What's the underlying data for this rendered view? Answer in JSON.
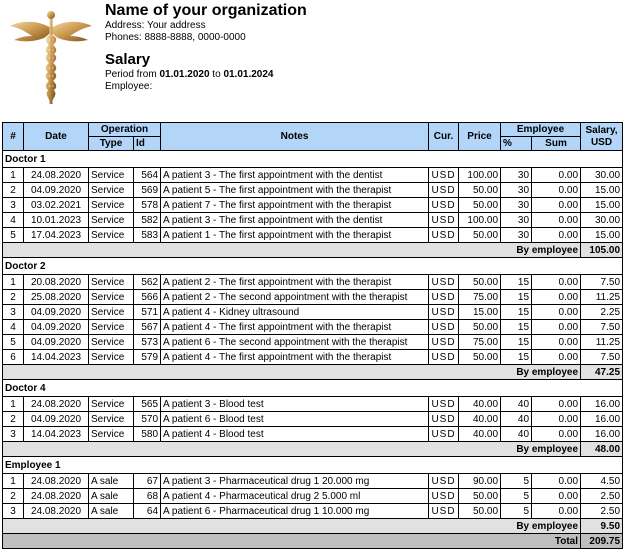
{
  "header": {
    "org_name": "Name of your organization",
    "address": "Address: Your address",
    "phones": "Phones: 8888-8888, 0000-0000",
    "title": "Salary",
    "period_prefix": "Period from ",
    "period_from": "01.01.2020",
    "period_mid": " to ",
    "period_to": "01.01.2024",
    "employee_label": "Employee:",
    "logo_icon": "caduceus-icon",
    "accent_gold": "#c9964a"
  },
  "table": {
    "columns": {
      "num": "#",
      "date": "Date",
      "operation": "Operation",
      "type": "Type",
      "id": "Id",
      "notes": "Notes",
      "cur": "Cur.",
      "price": "Price",
      "employee": "Employee",
      "pct": "%",
      "sum": "Sum",
      "salary": "Salary, USD"
    },
    "header_color": "#b3d5f7",
    "subtotal_label": "By employee",
    "total_label": "Total",
    "total_value": "209.75",
    "groups": [
      {
        "name": "Doctor 1",
        "subtotal": "105.00",
        "rows": [
          {
            "n": "1",
            "date": "24.08.2020",
            "type": "Service",
            "id": "564",
            "notes": "A patient 3 - The first appointment with the dentist",
            "cur": "USD",
            "price": "100.00",
            "pct": "30",
            "sum": "0.00",
            "salary": "30.00"
          },
          {
            "n": "2",
            "date": "04.09.2020",
            "type": "Service",
            "id": "569",
            "notes": "A patient 5 - The first appointment with the therapist",
            "cur": "USD",
            "price": "50.00",
            "pct": "30",
            "sum": "0.00",
            "salary": "15.00"
          },
          {
            "n": "3",
            "date": "03.02.2021",
            "type": "Service",
            "id": "578",
            "notes": "A patient 7 - The first appointment with the therapist",
            "cur": "USD",
            "price": "50.00",
            "pct": "30",
            "sum": "0.00",
            "salary": "15.00"
          },
          {
            "n": "4",
            "date": "10.01.2023",
            "type": "Service",
            "id": "582",
            "notes": "A patient 3 - The first appointment with the dentist",
            "cur": "USD",
            "price": "100.00",
            "pct": "30",
            "sum": "0.00",
            "salary": "30.00"
          },
          {
            "n": "5",
            "date": "17.04.2023",
            "type": "Service",
            "id": "583",
            "notes": "A patient 1 - The first appointment with the therapist",
            "cur": "USD",
            "price": "50.00",
            "pct": "30",
            "sum": "0.00",
            "salary": "15.00"
          }
        ]
      },
      {
        "name": "Doctor 2",
        "subtotal": "47.25",
        "rows": [
          {
            "n": "1",
            "date": "20.08.2020",
            "type": "Service",
            "id": "562",
            "notes": "A patient 2 - The first appointment with the therapist",
            "cur": "USD",
            "price": "50.00",
            "pct": "15",
            "sum": "0.00",
            "salary": "7.50"
          },
          {
            "n": "2",
            "date": "25.08.2020",
            "type": "Service",
            "id": "566",
            "notes": "A patient 2 - The second appointment with the therapist",
            "cur": "USD",
            "price": "75.00",
            "pct": "15",
            "sum": "0.00",
            "salary": "11.25"
          },
          {
            "n": "3",
            "date": "04.09.2020",
            "type": "Service",
            "id": "571",
            "notes": "A patient 4 - Kidney ultrasound",
            "cur": "USD",
            "price": "15.00",
            "pct": "15",
            "sum": "0.00",
            "salary": "2.25"
          },
          {
            "n": "4",
            "date": "04.09.2020",
            "type": "Service",
            "id": "567",
            "notes": "A patient 4 - The first appointment with the therapist",
            "cur": "USD",
            "price": "50.00",
            "pct": "15",
            "sum": "0.00",
            "salary": "7.50"
          },
          {
            "n": "5",
            "date": "04.09.2020",
            "type": "Service",
            "id": "573",
            "notes": "A patient 6 - The second appointment with the therapist",
            "cur": "USD",
            "price": "75.00",
            "pct": "15",
            "sum": "0.00",
            "salary": "11.25"
          },
          {
            "n": "6",
            "date": "14.04.2023",
            "type": "Service",
            "id": "579",
            "notes": "A patient 4 - The first appointment with the therapist",
            "cur": "USD",
            "price": "50.00",
            "pct": "15",
            "sum": "0.00",
            "salary": "7.50"
          }
        ]
      },
      {
        "name": "Doctor 4",
        "subtotal": "48.00",
        "rows": [
          {
            "n": "1",
            "date": "24.08.2020",
            "type": "Service",
            "id": "565",
            "notes": "A patient 3 - Blood test",
            "cur": "USD",
            "price": "40.00",
            "pct": "40",
            "sum": "0.00",
            "salary": "16.00"
          },
          {
            "n": "2",
            "date": "04.09.2020",
            "type": "Service",
            "id": "570",
            "notes": "A patient 6 - Blood test",
            "cur": "USD",
            "price": "40.00",
            "pct": "40",
            "sum": "0.00",
            "salary": "16.00"
          },
          {
            "n": "3",
            "date": "14.04.2023",
            "type": "Service",
            "id": "580",
            "notes": "A patient 4 - Blood test",
            "cur": "USD",
            "price": "40.00",
            "pct": "40",
            "sum": "0.00",
            "salary": "16.00"
          }
        ]
      },
      {
        "name": "Employee 1",
        "subtotal": "9.50",
        "rows": [
          {
            "n": "1",
            "date": "24.08.2020",
            "type": "A sale",
            "id": "67",
            "notes": "A patient 3 - Pharmaceutical drug 1 20.000 mg",
            "cur": "USD",
            "price": "90.00",
            "pct": "5",
            "sum": "0.00",
            "salary": "4.50"
          },
          {
            "n": "2",
            "date": "24.08.2020",
            "type": "A sale",
            "id": "68",
            "notes": "A patient 4 - Pharmaceutical drug 2 5.000 ml",
            "cur": "USD",
            "price": "50.00",
            "pct": "5",
            "sum": "0.00",
            "salary": "2.50"
          },
          {
            "n": "3",
            "date": "24.08.2020",
            "type": "A sale",
            "id": "64",
            "notes": "A patient 6 - Pharmaceutical drug 1 10.000 mg",
            "cur": "USD",
            "price": "50.00",
            "pct": "5",
            "sum": "0.00",
            "salary": "2.50"
          }
        ]
      }
    ]
  }
}
